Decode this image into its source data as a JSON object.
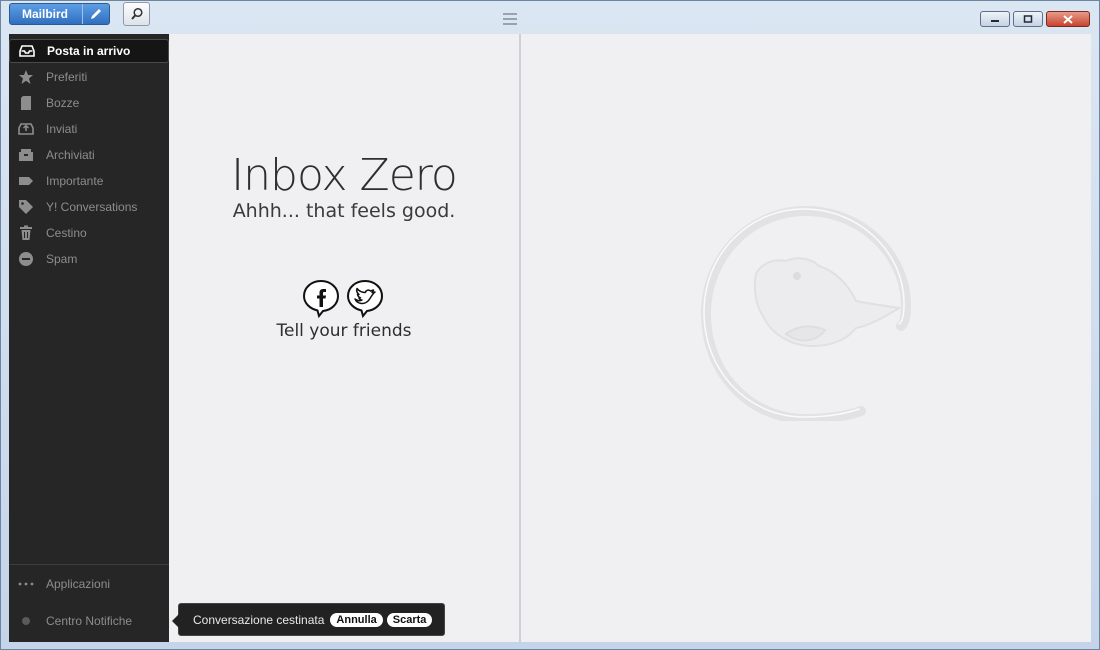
{
  "app": {
    "brand_label": "Mailbird"
  },
  "sidebar": {
    "items": [
      {
        "label": "Posta in arrivo",
        "icon": "inbox-icon",
        "active": true
      },
      {
        "label": "Preferiti",
        "icon": "star-icon"
      },
      {
        "label": "Bozze",
        "icon": "draft-icon"
      },
      {
        "label": "Inviati",
        "icon": "sent-icon"
      },
      {
        "label": "Archiviati",
        "icon": "archive-icon"
      },
      {
        "label": "Importante",
        "icon": "label-icon"
      },
      {
        "label": "Y! Conversations",
        "icon": "tag-icon"
      },
      {
        "label": "Cestino",
        "icon": "trash-icon"
      },
      {
        "label": "Spam",
        "icon": "spam-icon"
      }
    ],
    "apps_label": "Applicazioni",
    "notifications_label": "Centro Notifiche"
  },
  "empty_state": {
    "title": "Inbox Zero",
    "subtitle": "Ahhh... that feels good.",
    "share_label": "Tell your friends"
  },
  "toast": {
    "message": "Conversazione cestinata",
    "undo_label": "Annulla",
    "discard_label": "Scarta"
  },
  "colors": {
    "brand_blue": "#3d7fd0",
    "sidebar_bg": "#262626",
    "panel_bg": "#f0f0f2",
    "close_red": "#c7432f"
  }
}
